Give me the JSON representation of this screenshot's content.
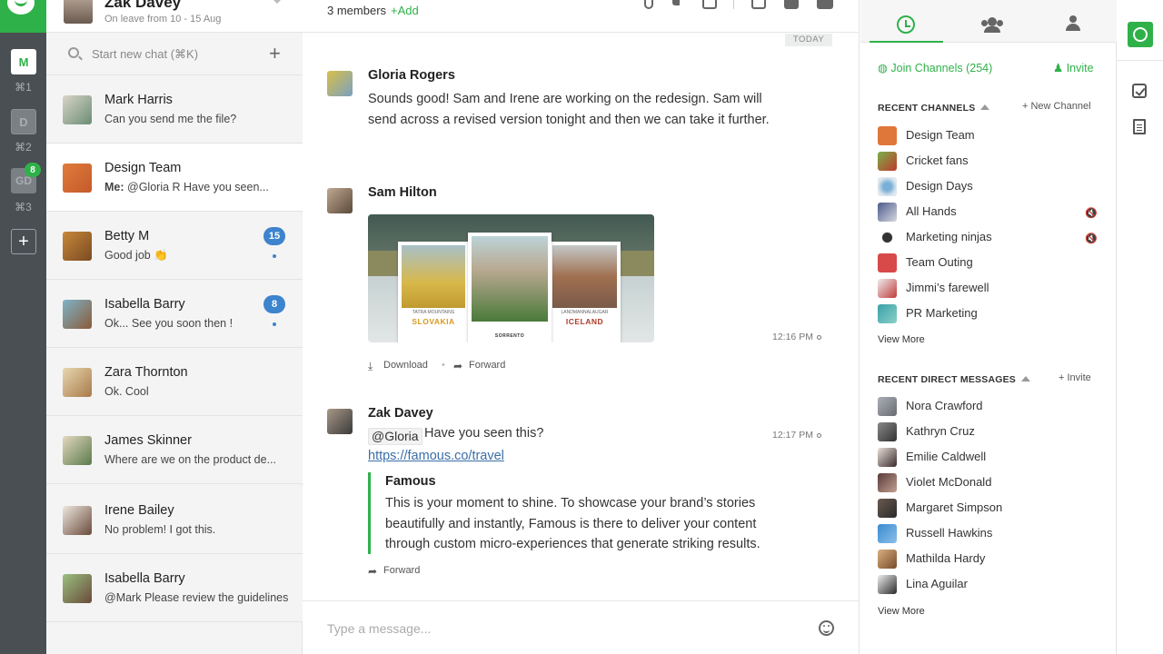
{
  "header": {
    "user_name": "Zak Davey",
    "user_status": "On leave from 10 - 15 Aug"
  },
  "rail": {
    "workspaces": [
      {
        "label": "M",
        "shortcut": "⌘1"
      },
      {
        "label": "D",
        "shortcut": "⌘2"
      },
      {
        "label": "GD",
        "shortcut": "⌘3",
        "badge": "8"
      }
    ],
    "add_label": "+"
  },
  "search": {
    "placeholder": "Start new chat (⌘K)"
  },
  "chats": [
    {
      "name": "Mark Harris",
      "preview": "Can you send me the file?"
    },
    {
      "name": "Design Team",
      "preview_prefix": "Me:",
      "preview": "@Gloria R Have you seen..."
    },
    {
      "name": "Betty M",
      "preview": "Good job 👏",
      "badge": "15"
    },
    {
      "name": "Isabella Barry",
      "preview": "Ok... See you soon then !",
      "badge": "8"
    },
    {
      "name": "Zara Thornton",
      "preview": "Ok. Cool"
    },
    {
      "name": "James Skinner",
      "preview": "Where are we on the product de..."
    },
    {
      "name": "Irene Bailey",
      "preview": "No problem! I got this."
    },
    {
      "name": "Isabella Barry",
      "preview": "@Mark Please review the guidelines"
    }
  ],
  "conversation": {
    "members": "3 members",
    "add_label": "+Add",
    "date_divider": "TODAY",
    "messages": [
      {
        "author": "Gloria Rogers",
        "text": "Sounds good! Sam and Irene are working on the redesign. Sam will send across a revised version tonight and then we can take it further."
      },
      {
        "author": "Sam Hilton",
        "time": "12:16 PM",
        "attachment": {
          "posters": [
            {
              "title": "SLOVAKIA",
              "subtitle": "TATRA MOUNTAINS"
            },
            {
              "title": "SORRENTO",
              "subtitle": ""
            },
            {
              "title": "ICELAND",
              "subtitle": "LANDMANNALAUGAR"
            }
          ]
        },
        "actions": {
          "download": "Download",
          "forward": "Forward"
        }
      },
      {
        "author": "Zak Davey",
        "time": "12:17 PM",
        "mention": "@Gloria",
        "text": "Have you seen this?",
        "link": "https://famous.co/travel",
        "preview_title": "Famous",
        "preview_text": "This is your moment to shine. To showcase your brand’s stories beautifully and instantly, Famous is there to deliver your content through custom micro-experiences that generate striking results.",
        "forward": "Forward"
      }
    ],
    "composer_placeholder": "Type a message..."
  },
  "panel": {
    "join_label": "Join Channels (254)",
    "invite_label": "Invite",
    "recent_channels_title": "RECENT CHANNELS",
    "new_channel_label": "+ New Channel",
    "channels": [
      {
        "name": "Design Team",
        "muted": false
      },
      {
        "name": "Cricket fans",
        "muted": false
      },
      {
        "name": "Design Days",
        "muted": false
      },
      {
        "name": "All Hands",
        "muted": true
      },
      {
        "name": "Marketing ninjas",
        "muted": true
      },
      {
        "name": "Team Outing",
        "muted": false
      },
      {
        "name": "Jimmi’s farewell",
        "muted": false
      },
      {
        "name": "PR Marketing",
        "muted": false
      }
    ],
    "view_more": "View More",
    "recent_dm_title": "RECENT DIRECT MESSAGES",
    "dm_invite_label": "+ Invite",
    "direct_messages": [
      "Nora Crawford",
      "Kathryn Cruz",
      "Emilie Caldwell",
      "Violet McDonald",
      "Margaret Simpson",
      "Russell Hawkins",
      "Mathilda Hardy",
      "Lina Aguilar"
    ],
    "view_more_dm": "View More"
  },
  "colors": {
    "accent": "#2fb14a",
    "badge": "#3d83cd",
    "rail": "#4a4f53"
  }
}
